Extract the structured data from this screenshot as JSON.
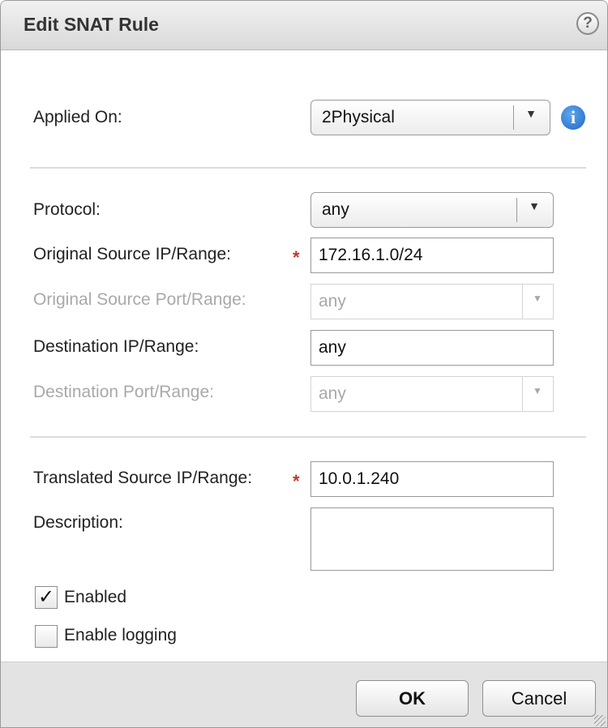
{
  "dialog": {
    "title": "Edit SNAT Rule",
    "help_icon": "help-icon"
  },
  "applied_on": {
    "label": "Applied On:",
    "value": "2Physical",
    "info_icon": "info-icon"
  },
  "protocol": {
    "label": "Protocol:",
    "value": "any"
  },
  "original_source_ip": {
    "label": "Original Source IP/Range:",
    "required_mark": "*",
    "value": "172.16.1.0/24"
  },
  "original_source_port": {
    "label": "Original Source Port/Range:",
    "value": "any",
    "disabled": true
  },
  "destination_ip": {
    "label": "Destination IP/Range:",
    "value": "any"
  },
  "destination_port": {
    "label": "Destination Port/Range:",
    "value": "any",
    "disabled": true
  },
  "translated_source_ip": {
    "label": "Translated Source IP/Range:",
    "required_mark": "*",
    "value": "10.0.1.240"
  },
  "description": {
    "label": "Description:",
    "value": ""
  },
  "enabled": {
    "label": "Enabled",
    "checked": true,
    "check_glyph": "✓"
  },
  "enable_logging": {
    "label": "Enable logging",
    "checked": false
  },
  "buttons": {
    "ok": "OK",
    "cancel": "Cancel"
  },
  "colors": {
    "required": "#c0392b",
    "info_blue": "#1f69c6",
    "disabled_text": "#a9a9a9"
  }
}
